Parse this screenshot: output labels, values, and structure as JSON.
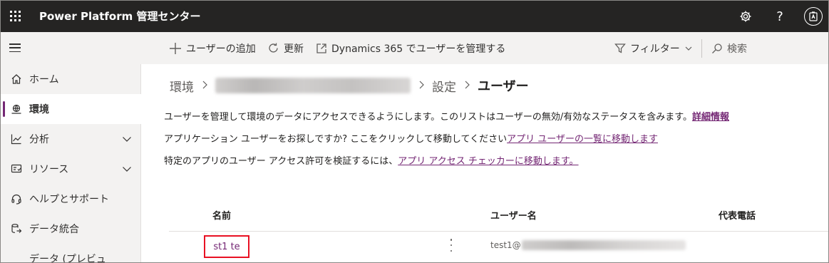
{
  "app": {
    "title": "Power Platform 管理センター"
  },
  "topbar": {
    "icons": [
      "waffle-icon",
      "settings-icon",
      "help-icon",
      "avatar-icon"
    ],
    "help_glyph": "?"
  },
  "commands": {
    "add_user": "ユーザーの追加",
    "refresh": "更新",
    "manage_in_dynamics": "Dynamics 365 でユーザーを管理する",
    "filter": "フィルター",
    "search": "検索"
  },
  "sidebar": {
    "items": [
      {
        "label": "ホーム",
        "icon": "home-icon"
      },
      {
        "label": "環境",
        "icon": "environment-icon",
        "active": true
      },
      {
        "label": "分析",
        "icon": "analytics-icon",
        "expandable": true
      },
      {
        "label": "リソース",
        "icon": "resources-icon",
        "expandable": true
      },
      {
        "label": "ヘルプとサポート",
        "icon": "headset-icon"
      },
      {
        "label": "データ統合",
        "icon": "data-integration-icon"
      },
      {
        "label": "データ (プレビュ",
        "icon": "data-preview-icon"
      }
    ]
  },
  "breadcrumb": {
    "root": "環境",
    "settings": "設定",
    "current": "ユーザー"
  },
  "info": {
    "line1_text": "ユーザーを管理して環境のデータにアクセスできるようにします。このリストはユーザーの無効/有効なステータスを含みます。",
    "line1_link": "詳細情報",
    "line2_text": "アプリケーション ユーザーをお探しですか? ここをクリックして移動してください",
    "line2_link": "アプリ ユーザーの一覧に移動します",
    "line3_text": "特定のアプリのユーザー アクセス許可を検証するには、",
    "line3_link": "アプリ アクセス チェッカーに移動します。"
  },
  "table": {
    "columns": [
      "名前",
      "ユーザー名",
      "代表電話"
    ],
    "rows": [
      {
        "name": "st1 te",
        "username_prefix": "test1@"
      }
    ]
  },
  "colors": {
    "topbar": "#252423",
    "accent": "#742774",
    "highlight_box": "#e81123"
  }
}
